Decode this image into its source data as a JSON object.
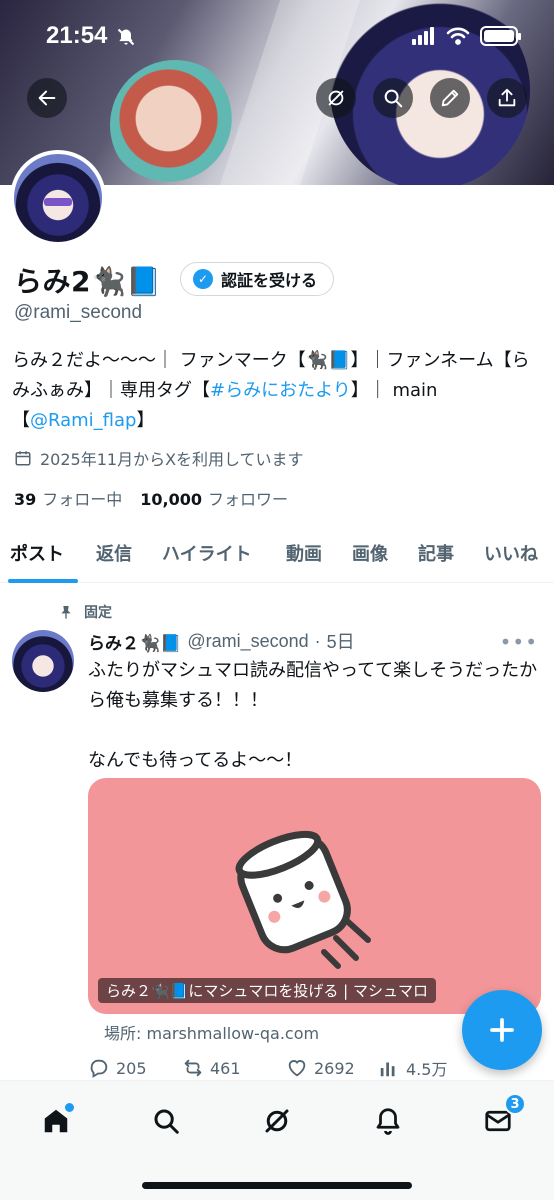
{
  "status_bar": {
    "time": "21:54"
  },
  "profile": {
    "display_name": "らみ2🐈‍⬛📘",
    "verify_button_label": "認証を受ける",
    "handle": "@rami_second",
    "bio_parts": [
      {
        "text": "らみ２だよ〜〜〜｜ ファンマーク【🐈‍⬛📘】｜ファンネーム【らみふぁみ】｜専用タグ【",
        "link": false
      },
      {
        "text": "#らみにおたより",
        "link": true
      },
      {
        "text": "】｜ main 【",
        "link": false
      },
      {
        "text": "@Rami_flap",
        "link": true
      },
      {
        "text": "】",
        "link": false
      }
    ],
    "joined": "2025年11月からXを利用しています",
    "following_count": "39",
    "following_label": "フォロー中",
    "followers_count": "10,000",
    "followers_label": "フォロワー"
  },
  "tabs": [
    "ポスト",
    "返信",
    "ハイライト",
    "動画",
    "画像",
    "記事",
    "いいね"
  ],
  "active_tab": "ポスト",
  "post": {
    "pinned_label": "固定",
    "author_name": "らみ２🐈‍⬛📘",
    "author_handle": "@rami_second",
    "time": "5日",
    "text": "ふたりがマシュマロ読み配信やってて楽しそうだったから俺も募集する！！！\n\nなんでも待ってるよ〜〜！",
    "card_caption": "らみ２🐈‍⬛📘にマシュマロを投げる | マシュマロ",
    "card_domain": "場所: marshmallow-qa.com",
    "card_color": "#f29699",
    "replies": "205",
    "reposts": "461",
    "likes": "2692",
    "views": "4.5万"
  },
  "bottom_nav": {
    "items": [
      "home-icon",
      "search-icon",
      "grok-icon",
      "notifications-icon",
      "messages-icon"
    ],
    "messages_badge": "3"
  },
  "colors": {
    "accent": "#1d9bf0",
    "text": "#0f1419",
    "muted": "#536471"
  }
}
